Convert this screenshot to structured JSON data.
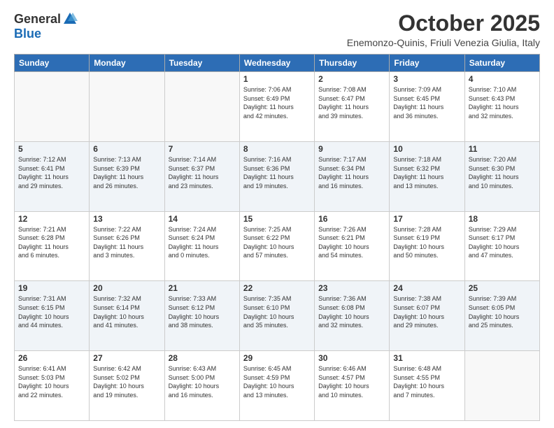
{
  "header": {
    "logo_general": "General",
    "logo_blue": "Blue",
    "title": "October 2025",
    "subtitle": "Enemonzo-Quinis, Friuli Venezia Giulia, Italy"
  },
  "weekdays": [
    "Sunday",
    "Monday",
    "Tuesday",
    "Wednesday",
    "Thursday",
    "Friday",
    "Saturday"
  ],
  "weeks": [
    [
      {
        "day": "",
        "info": ""
      },
      {
        "day": "",
        "info": ""
      },
      {
        "day": "",
        "info": ""
      },
      {
        "day": "1",
        "info": "Sunrise: 7:06 AM\nSunset: 6:49 PM\nDaylight: 11 hours\nand 42 minutes."
      },
      {
        "day": "2",
        "info": "Sunrise: 7:08 AM\nSunset: 6:47 PM\nDaylight: 11 hours\nand 39 minutes."
      },
      {
        "day": "3",
        "info": "Sunrise: 7:09 AM\nSunset: 6:45 PM\nDaylight: 11 hours\nand 36 minutes."
      },
      {
        "day": "4",
        "info": "Sunrise: 7:10 AM\nSunset: 6:43 PM\nDaylight: 11 hours\nand 32 minutes."
      }
    ],
    [
      {
        "day": "5",
        "info": "Sunrise: 7:12 AM\nSunset: 6:41 PM\nDaylight: 11 hours\nand 29 minutes."
      },
      {
        "day": "6",
        "info": "Sunrise: 7:13 AM\nSunset: 6:39 PM\nDaylight: 11 hours\nand 26 minutes."
      },
      {
        "day": "7",
        "info": "Sunrise: 7:14 AM\nSunset: 6:37 PM\nDaylight: 11 hours\nand 23 minutes."
      },
      {
        "day": "8",
        "info": "Sunrise: 7:16 AM\nSunset: 6:36 PM\nDaylight: 11 hours\nand 19 minutes."
      },
      {
        "day": "9",
        "info": "Sunrise: 7:17 AM\nSunset: 6:34 PM\nDaylight: 11 hours\nand 16 minutes."
      },
      {
        "day": "10",
        "info": "Sunrise: 7:18 AM\nSunset: 6:32 PM\nDaylight: 11 hours\nand 13 minutes."
      },
      {
        "day": "11",
        "info": "Sunrise: 7:20 AM\nSunset: 6:30 PM\nDaylight: 11 hours\nand 10 minutes."
      }
    ],
    [
      {
        "day": "12",
        "info": "Sunrise: 7:21 AM\nSunset: 6:28 PM\nDaylight: 11 hours\nand 6 minutes."
      },
      {
        "day": "13",
        "info": "Sunrise: 7:22 AM\nSunset: 6:26 PM\nDaylight: 11 hours\nand 3 minutes."
      },
      {
        "day": "14",
        "info": "Sunrise: 7:24 AM\nSunset: 6:24 PM\nDaylight: 11 hours\nand 0 minutes."
      },
      {
        "day": "15",
        "info": "Sunrise: 7:25 AM\nSunset: 6:22 PM\nDaylight: 10 hours\nand 57 minutes."
      },
      {
        "day": "16",
        "info": "Sunrise: 7:26 AM\nSunset: 6:21 PM\nDaylight: 10 hours\nand 54 minutes."
      },
      {
        "day": "17",
        "info": "Sunrise: 7:28 AM\nSunset: 6:19 PM\nDaylight: 10 hours\nand 50 minutes."
      },
      {
        "day": "18",
        "info": "Sunrise: 7:29 AM\nSunset: 6:17 PM\nDaylight: 10 hours\nand 47 minutes."
      }
    ],
    [
      {
        "day": "19",
        "info": "Sunrise: 7:31 AM\nSunset: 6:15 PM\nDaylight: 10 hours\nand 44 minutes."
      },
      {
        "day": "20",
        "info": "Sunrise: 7:32 AM\nSunset: 6:14 PM\nDaylight: 10 hours\nand 41 minutes."
      },
      {
        "day": "21",
        "info": "Sunrise: 7:33 AM\nSunset: 6:12 PM\nDaylight: 10 hours\nand 38 minutes."
      },
      {
        "day": "22",
        "info": "Sunrise: 7:35 AM\nSunset: 6:10 PM\nDaylight: 10 hours\nand 35 minutes."
      },
      {
        "day": "23",
        "info": "Sunrise: 7:36 AM\nSunset: 6:08 PM\nDaylight: 10 hours\nand 32 minutes."
      },
      {
        "day": "24",
        "info": "Sunrise: 7:38 AM\nSunset: 6:07 PM\nDaylight: 10 hours\nand 29 minutes."
      },
      {
        "day": "25",
        "info": "Sunrise: 7:39 AM\nSunset: 6:05 PM\nDaylight: 10 hours\nand 25 minutes."
      }
    ],
    [
      {
        "day": "26",
        "info": "Sunrise: 6:41 AM\nSunset: 5:03 PM\nDaylight: 10 hours\nand 22 minutes."
      },
      {
        "day": "27",
        "info": "Sunrise: 6:42 AM\nSunset: 5:02 PM\nDaylight: 10 hours\nand 19 minutes."
      },
      {
        "day": "28",
        "info": "Sunrise: 6:43 AM\nSunset: 5:00 PM\nDaylight: 10 hours\nand 16 minutes."
      },
      {
        "day": "29",
        "info": "Sunrise: 6:45 AM\nSunset: 4:59 PM\nDaylight: 10 hours\nand 13 minutes."
      },
      {
        "day": "30",
        "info": "Sunrise: 6:46 AM\nSunset: 4:57 PM\nDaylight: 10 hours\nand 10 minutes."
      },
      {
        "day": "31",
        "info": "Sunrise: 6:48 AM\nSunset: 4:55 PM\nDaylight: 10 hours\nand 7 minutes."
      },
      {
        "day": "",
        "info": ""
      }
    ]
  ]
}
